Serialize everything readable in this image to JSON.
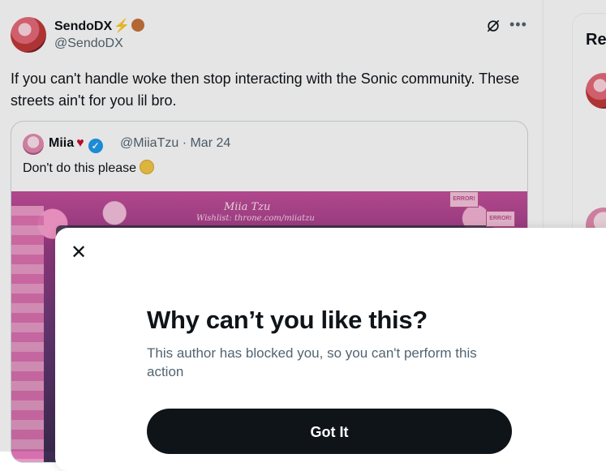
{
  "tweet": {
    "author_name": "SendoDX",
    "author_bolt": "⚡",
    "author_handle": "@SendoDX",
    "text": "If you can't handle woke then stop interacting with the Sonic community. These streets ain't for you lil bro."
  },
  "quote": {
    "author_name": "Miia",
    "heart": "♥",
    "verified_mark": "✓",
    "handle_date": "@MiiaTzu · Mar 24",
    "text": "Don't do this please",
    "image": {
      "title": "Miia Tzu",
      "subtitle": "Wishlist: throne.com/miiatzu",
      "warning_label": "ERROR!"
    }
  },
  "sidebar": {
    "title": "Re"
  },
  "modal": {
    "close_glyph": "✕",
    "title": "Why can’t you like this?",
    "body": "This author has blocked you, so you can't perform this action",
    "button_label": "Got It"
  },
  "colors": {
    "accent": "#1d9bf0",
    "text_primary": "#0f1419",
    "text_secondary": "#536471",
    "button_bg": "#0f1419"
  }
}
